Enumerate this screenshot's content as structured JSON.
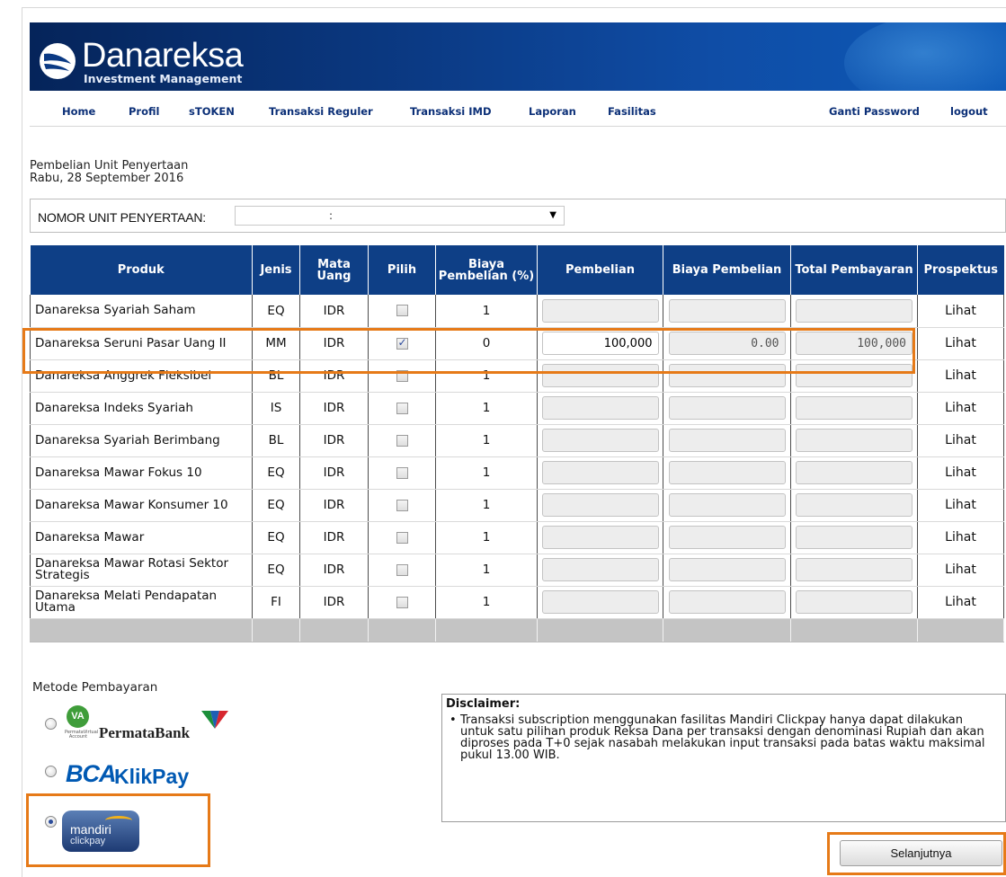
{
  "brand": {
    "name": "Danareksa",
    "tagline": "Investment Management"
  },
  "nav": {
    "home": "Home",
    "profil": "Profil",
    "stoken": "sTOKEN",
    "transaksi_reguler": "Transaksi Reguler",
    "transaksi_imd": "Transaksi IMD",
    "laporan": "Laporan",
    "fasilitas": "Fasilitas",
    "ganti_password": "Ganti Password",
    "logout": "logout"
  },
  "page": {
    "title": "Pembelian Unit Penyertaan",
    "date": "Rabu, 28 September 2016"
  },
  "nomor": {
    "label": "NOMOR UNIT PENYERTAAN:",
    "value": ":"
  },
  "table": {
    "headers": {
      "produk": "Produk",
      "jenis": "Jenis",
      "mata_uang": "Mata Uang",
      "pilih": "Pilih",
      "biaya_persen": "Biaya Pembelian (%)",
      "pembelian": "Pembelian",
      "biaya_pembelian": "Biaya Pembelian",
      "total": "Total Pembayaran",
      "prospektus": "Prospektus"
    },
    "rows": [
      {
        "produk": "Danareksa Syariah Saham",
        "jenis": "EQ",
        "mata_uang": "IDR",
        "pilih": false,
        "biaya": "1",
        "pembelian": "",
        "biaya_pembelian": "",
        "total": "",
        "prospektus": "Lihat"
      },
      {
        "produk": "Danareksa Seruni Pasar Uang II",
        "jenis": "MM",
        "mata_uang": "IDR",
        "pilih": true,
        "biaya": "0",
        "pembelian": "100,000",
        "biaya_pembelian": "0.00",
        "total": "100,000",
        "prospektus": "Lihat"
      },
      {
        "produk": "Danareksa Anggrek Fleksibel",
        "jenis": "BL",
        "mata_uang": "IDR",
        "pilih": false,
        "biaya": "1",
        "pembelian": "",
        "biaya_pembelian": "",
        "total": "",
        "prospektus": "Lihat"
      },
      {
        "produk": "Danareksa Indeks Syariah",
        "jenis": "IS",
        "mata_uang": "IDR",
        "pilih": false,
        "biaya": "1",
        "pembelian": "",
        "biaya_pembelian": "",
        "total": "",
        "prospektus": "Lihat"
      },
      {
        "produk": "Danareksa Syariah Berimbang",
        "jenis": "BL",
        "mata_uang": "IDR",
        "pilih": false,
        "biaya": "1",
        "pembelian": "",
        "biaya_pembelian": "",
        "total": "",
        "prospektus": "Lihat"
      },
      {
        "produk": "Danareksa Mawar Fokus 10",
        "jenis": "EQ",
        "mata_uang": "IDR",
        "pilih": false,
        "biaya": "1",
        "pembelian": "",
        "biaya_pembelian": "",
        "total": "",
        "prospektus": "Lihat"
      },
      {
        "produk": "Danareksa Mawar Konsumer 10",
        "jenis": "EQ",
        "mata_uang": "IDR",
        "pilih": false,
        "biaya": "1",
        "pembelian": "",
        "biaya_pembelian": "",
        "total": "",
        "prospektus": "Lihat"
      },
      {
        "produk": "Danareksa Mawar",
        "jenis": "EQ",
        "mata_uang": "IDR",
        "pilih": false,
        "biaya": "1",
        "pembelian": "",
        "biaya_pembelian": "",
        "total": "",
        "prospektus": "Lihat"
      },
      {
        "produk": "Danareksa Mawar Rotasi Sektor Strategis",
        "jenis": "EQ",
        "mata_uang": "IDR",
        "pilih": false,
        "biaya": "1",
        "pembelian": "",
        "biaya_pembelian": "",
        "total": "",
        "prospektus": "Lihat"
      },
      {
        "produk": "Danareksa Melati Pendapatan Utama",
        "jenis": "FI",
        "mata_uang": "IDR",
        "pilih": false,
        "biaya": "1",
        "pembelian": "",
        "biaya_pembelian": "",
        "total": "",
        "prospektus": "Lihat"
      }
    ]
  },
  "payment": {
    "title": "Metode Pembayaran",
    "va_label": "VA",
    "va_sub": "PermataVirtual Account",
    "permata_label": "PermataBank",
    "bca_mark": "BCA",
    "bca_word": "KlikPay",
    "mandiri_label": "mandiri",
    "mandiri_sub": "clickpay",
    "selected": "mandiri"
  },
  "disclaimer": {
    "title": "Disclaimer:",
    "text": "Transaksi subscription menggunakan fasilitas Mandiri Clickpay hanya dapat dilakukan untuk satu pilihan produk Reksa Dana per transaksi dengan denominasi Rupiah dan akan diproses pada T+0 sejak nasabah melakukan input transaksi pada batas waktu maksimal pukul 13.00 WIB."
  },
  "buttons": {
    "next": "Selanjutnya"
  },
  "colors": {
    "header_blue": "#0e3f86",
    "nav_text": "#0b2f77",
    "highlight": "#e67a18"
  }
}
